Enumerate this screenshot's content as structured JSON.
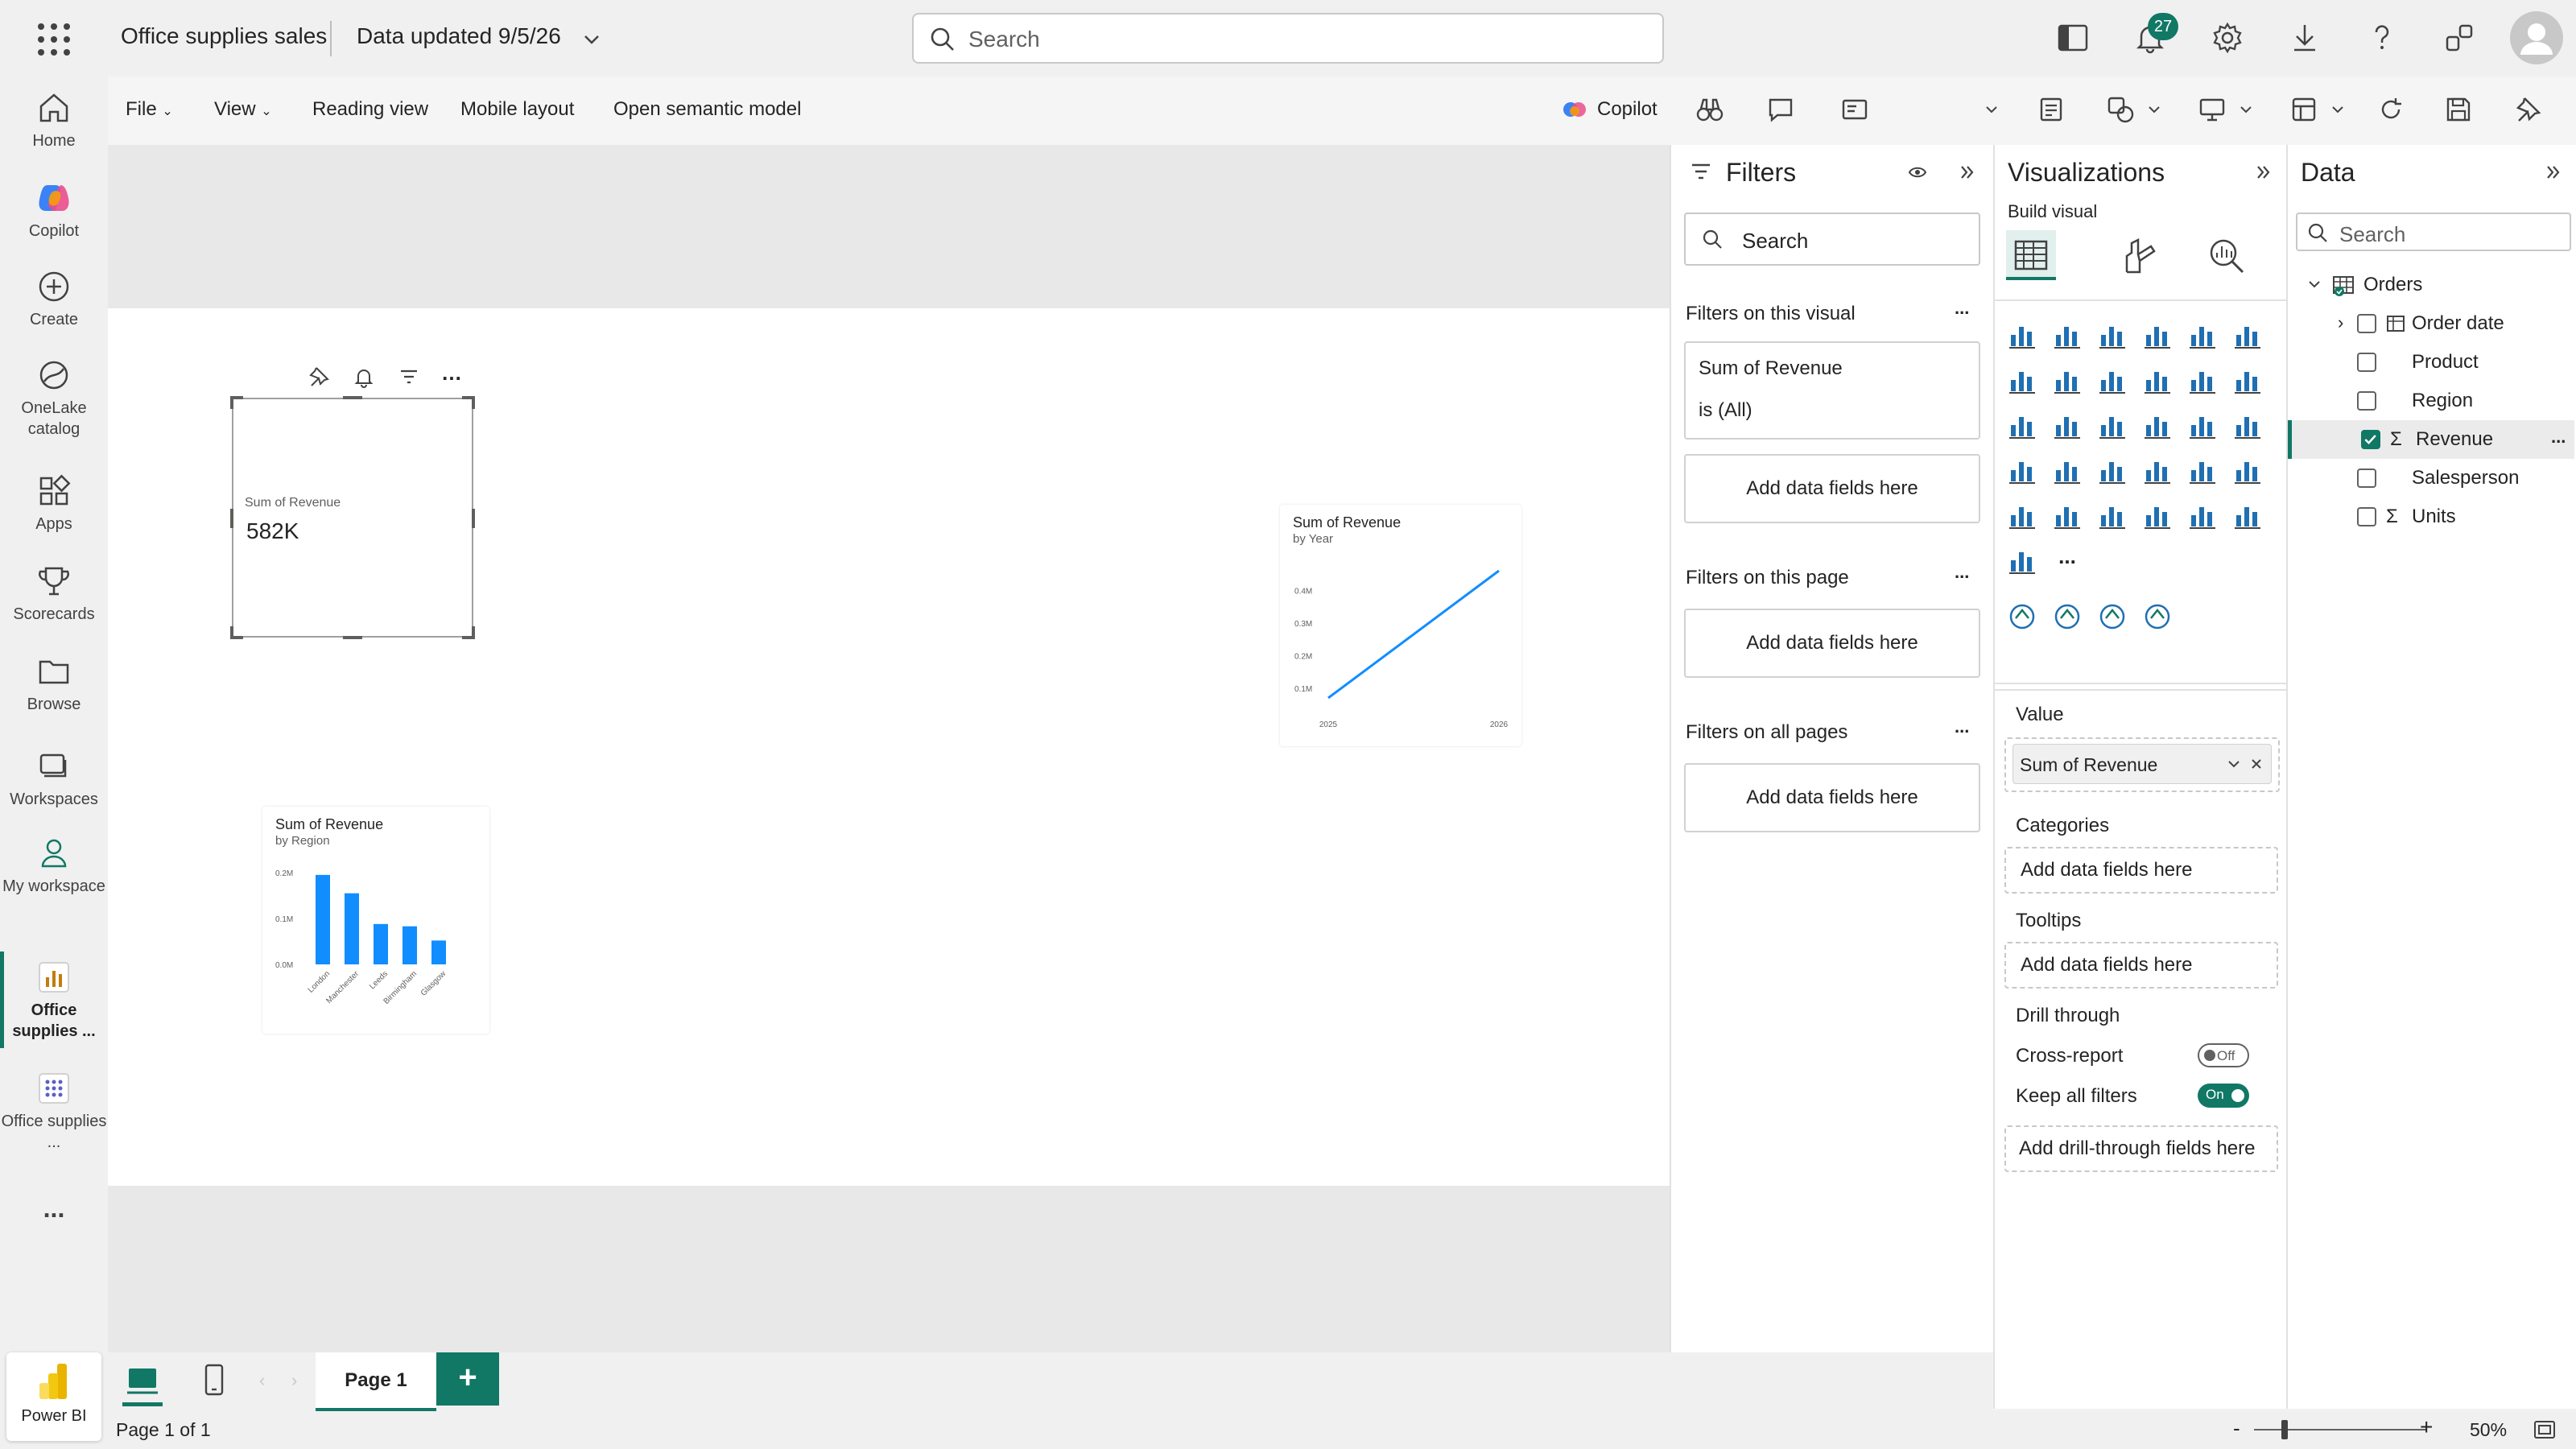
{
  "header": {
    "app_title": "Office supplies sales",
    "data_updated": "Data updated 9/5/26",
    "search_placeholder": "Search",
    "notification_count": "27",
    "accent_color": "#117865"
  },
  "nav": {
    "items": [
      {
        "label": "Home",
        "icon": "home-icon"
      },
      {
        "label": "Copilot",
        "icon": "copilot-icon"
      },
      {
        "label": "Create",
        "icon": "plus-circle-icon"
      },
      {
        "label": "OneLake catalog",
        "icon": "onelake-icon"
      },
      {
        "label": "Apps",
        "icon": "apps-icon"
      },
      {
        "label": "Scorecards",
        "icon": "trophy-icon"
      },
      {
        "label": "Browse",
        "icon": "folder-icon"
      },
      {
        "label": "Workspaces",
        "icon": "workspaces-icon"
      },
      {
        "label": "My workspace",
        "icon": "person-icon"
      },
      {
        "label": "Office supplies ...",
        "icon": "report-icon"
      },
      {
        "label": "Office supplies ...",
        "icon": "semantic-model-icon"
      }
    ],
    "more": "...",
    "product": "Power BI"
  },
  "ribbon": {
    "file": "File",
    "view": "View",
    "reading_view": "Reading view",
    "mobile_layout": "Mobile layout",
    "open_model": "Open semantic model",
    "copilot": "Copilot"
  },
  "visuals": {
    "card": {
      "label": "Sum of Revenue",
      "value": "582K"
    },
    "line": {
      "title": "Sum of Revenue",
      "subtitle": "by Year",
      "ticks_y": [
        "0.4M",
        "0.3M",
        "0.2M",
        "0.1M"
      ],
      "ticks_x": [
        "2025",
        "2026"
      ]
    },
    "bar": {
      "title": "Sum of Revenue",
      "subtitle": "by Region",
      "ticks_y": [
        "0.2M",
        "0.1M",
        "0.0M"
      ]
    }
  },
  "chart_data": [
    {
      "type": "line",
      "title": "Sum of Revenue",
      "subtitle": "by Year",
      "x": [
        "2025",
        "2026"
      ],
      "series": [
        {
          "values": [
            0.07,
            0.46
          ]
        }
      ],
      "ylim": [
        0.07,
        0.46
      ],
      "yticks": [
        "0.1M",
        "0.2M",
        "0.3M",
        "0.4M"
      ],
      "color": "#118dff"
    },
    {
      "type": "bar",
      "title": "Sum of Revenue",
      "subtitle": "by Region",
      "categories": [
        "London",
        "Manchester",
        "Leeds",
        "Birmingham",
        "Glasgow"
      ],
      "values": [
        0.195,
        0.155,
        0.088,
        0.083,
        0.052
      ],
      "ylim": [
        0,
        0.2
      ],
      "yticks": [
        "0.0M",
        "0.1M",
        "0.2M"
      ],
      "color": "#118dff"
    }
  ],
  "filters": {
    "title": "Filters",
    "search_placeholder": "Search",
    "on_visual": "Filters on this visual",
    "filter_card_field": "Sum of Revenue",
    "filter_card_state": "is (All)",
    "add_fields": "Add data fields here",
    "on_page": "Filters on this page",
    "on_all_pages": "Filters on all pages",
    "more": "..."
  },
  "visualizations": {
    "title": "Visualizations",
    "build_visual": "Build visual",
    "value_label": "Value",
    "value_field": "Sum of Revenue",
    "categories_label": "Categories",
    "add_fields": "Add data fields here",
    "tooltips_label": "Tooltips",
    "drill_through": "Drill through",
    "cross_report": "Cross-report",
    "cross_report_state": "Off",
    "keep_filters": "Keep all filters",
    "keep_filters_state": "On",
    "add_drill": "Add drill-through fields here",
    "more": "..."
  },
  "data_pane": {
    "title": "Data",
    "search_placeholder": "Search",
    "table": "Orders",
    "fields": [
      {
        "name": "Order date",
        "checked": false,
        "sigma": false,
        "table_icon": true
      },
      {
        "name": "Product",
        "checked": false,
        "sigma": false
      },
      {
        "name": "Region",
        "checked": false,
        "sigma": false
      },
      {
        "name": "Revenue",
        "checked": true,
        "sigma": true
      },
      {
        "name": "Salesperson",
        "checked": false,
        "sigma": false
      },
      {
        "name": "Units",
        "checked": false,
        "sigma": true
      }
    ],
    "more": "..."
  },
  "pages": {
    "tab": "Page 1",
    "add": "+",
    "status": "Page 1 of 1",
    "zoom": "50%",
    "zoom_minus": "-",
    "zoom_plus": "+"
  }
}
